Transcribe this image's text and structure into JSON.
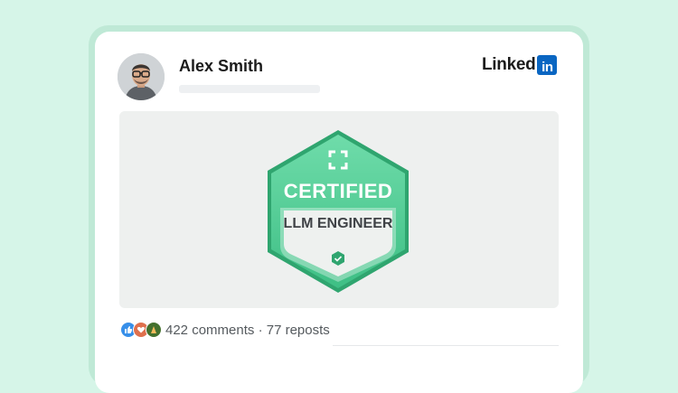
{
  "post": {
    "author_name": "Alex Smith",
    "brand": {
      "word": "Linked",
      "box": "in"
    },
    "badge": {
      "title": "CERTIFIED",
      "label": "LLM ENGINEER"
    },
    "reactions": [
      "like-icon",
      "love-icon",
      "celebrate-icon"
    ],
    "comments": "422 comments",
    "separator": "·",
    "reposts": "77 reposts"
  },
  "colors": {
    "background": "#d6f5e8",
    "badge_green": "#4ccb90",
    "linkedin_blue": "#0a66c2"
  }
}
